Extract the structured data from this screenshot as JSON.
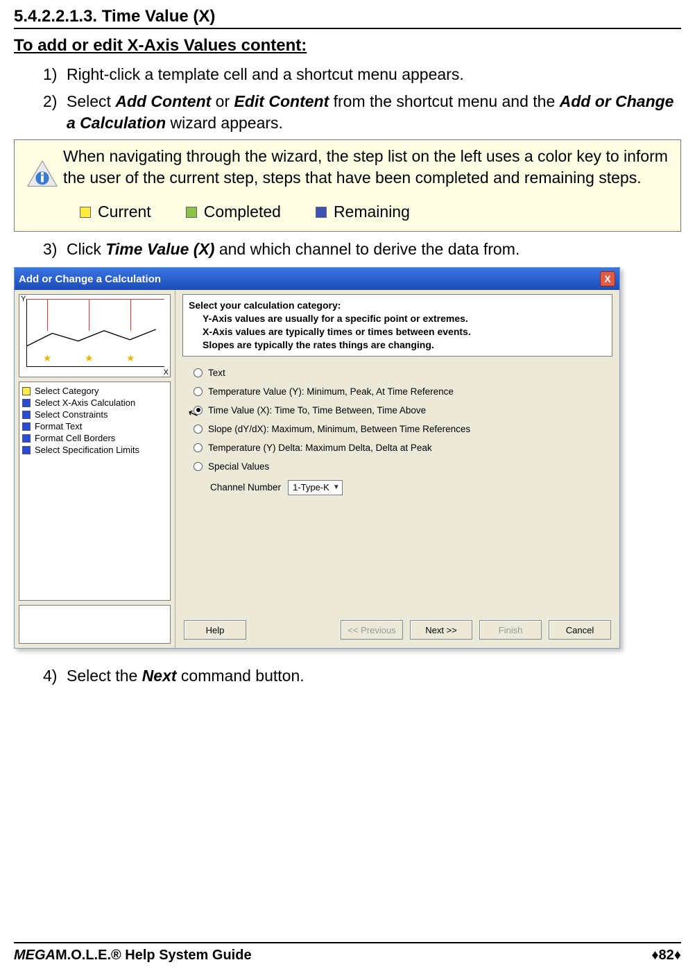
{
  "section_number": "5.4.2.2.1.3. Time Value (X)",
  "sub_header": "To add or edit X-Axis Values content:",
  "steps_text": {
    "s1_num": "1)",
    "s1": "Right-click a template cell and a shortcut menu appears.",
    "s2_num": "2)",
    "s2_a": "Select ",
    "s2_b": "Add Content",
    "s2_c": " or ",
    "s2_d": "Edit Content",
    "s2_e": " from the shortcut menu and the ",
    "s2_f": "Add or Change a Calculation",
    "s2_g": " wizard appears.",
    "s3_num": "3)",
    "s3_a": "Click ",
    "s3_b": "Time Value (X)",
    "s3_c": " and which channel to derive the data from.",
    "s4_num": "4)",
    "s4_a": "Select the ",
    "s4_b": "Next",
    "s4_c": " command button."
  },
  "note": {
    "text": "When navigating through the wizard, the step list on the left uses a color key to inform the user of the current step, steps that have been completed and remaining steps.",
    "current": "Current",
    "completed": "Completed",
    "remaining": "Remaining"
  },
  "dialog": {
    "title": "Add or Change a Calculation",
    "close": "X",
    "preview": {
      "y": "Y",
      "x": "X"
    },
    "steps": [
      {
        "color": "y",
        "label": "Select Category"
      },
      {
        "color": "b",
        "label": "Select X-Axis Calculation"
      },
      {
        "color": "b",
        "label": "Select Constraints"
      },
      {
        "color": "b",
        "label": "Format Text"
      },
      {
        "color": "b",
        "label": "Format Cell Borders"
      },
      {
        "color": "b",
        "label": "Select Specification Limits"
      }
    ],
    "cat_header": {
      "h1": "Select your calculation category:",
      "h2": "Y-Axis values are usually for a specific point or extremes.",
      "h3": "X-Axis values are typically times or times between events.",
      "h4": "Slopes are typically the rates things are changing."
    },
    "radios": {
      "text": "Text",
      "tempY": "Temperature Value (Y):  Minimum, Peak, At Time Reference",
      "timeX": "Time Value (X):  Time To, Time Between, Time Above",
      "slope": "Slope (dY/dX):  Maximum, Minimum, Between Time References",
      "delta": "Temperature (Y) Delta:  Maximum Delta, Delta at Peak",
      "special": "Special  Values"
    },
    "channel_label": "Channel Number",
    "channel_value": "1-Type-K",
    "buttons": {
      "help": "Help",
      "prev": "<< Previous",
      "next": "Next >>",
      "finish": "Finish",
      "cancel": "Cancel"
    }
  },
  "footer": {
    "left_a": "MEGA",
    "left_b": "M.O.L.E.® Help System Guide",
    "page": "82"
  }
}
